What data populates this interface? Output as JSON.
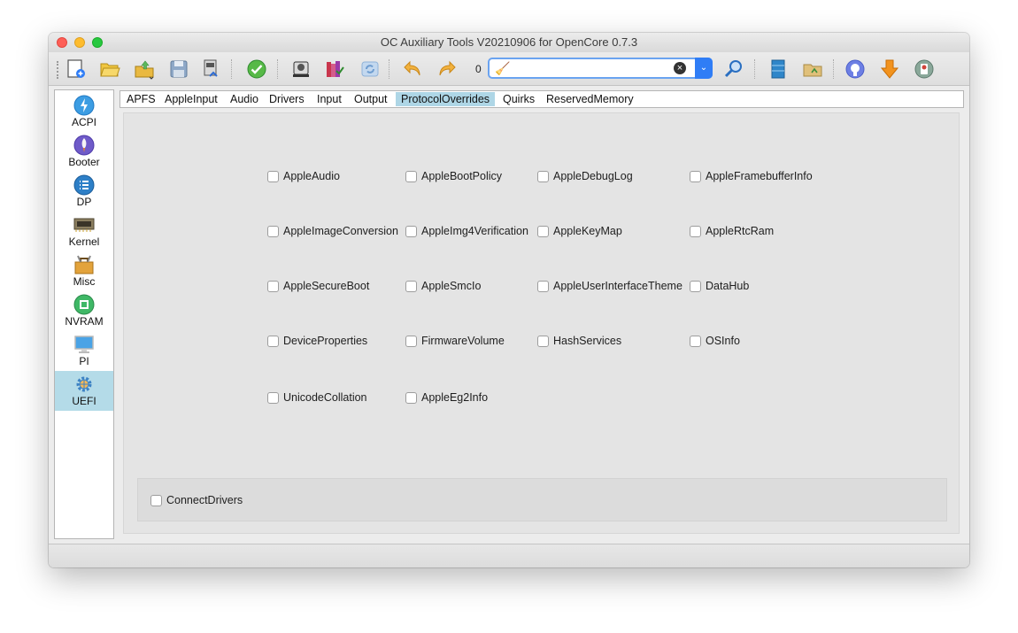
{
  "window": {
    "title": "OC Auxiliary Tools   V20210906 for OpenCore 0.7.3"
  },
  "toolbar": {
    "count": "0",
    "search": {
      "value": "",
      "placeholder": ""
    },
    "buttons": [
      {
        "name": "new-file",
        "icon": "new-document-icon"
      },
      {
        "name": "open-file",
        "icon": "folder-open-icon"
      },
      {
        "name": "open-recent",
        "icon": "folder-upload-icon"
      },
      {
        "name": "save",
        "icon": "floppy-disk-icon"
      },
      {
        "name": "save-as",
        "icon": "save-as-icon"
      },
      {
        "name": "check",
        "icon": "checkmark-icon"
      },
      {
        "name": "mount-esp",
        "icon": "disk-mount-icon"
      },
      {
        "name": "generate-ef",
        "icon": "books-icon"
      },
      {
        "name": "refresh",
        "icon": "refresh-icon"
      },
      {
        "name": "undo",
        "icon": "undo-arrow-icon"
      },
      {
        "name": "redo",
        "icon": "redo-arrow-icon"
      },
      {
        "name": "find",
        "icon": "magnifier-icon"
      },
      {
        "name": "database",
        "icon": "database-icon"
      },
      {
        "name": "open-dir",
        "icon": "folder-icon"
      },
      {
        "name": "github",
        "icon": "github-icon"
      },
      {
        "name": "download",
        "icon": "download-arrow-icon"
      },
      {
        "name": "about",
        "icon": "app-info-icon"
      }
    ]
  },
  "sidebar": {
    "items": [
      {
        "label": "ACPI",
        "icon": "lightning-icon"
      },
      {
        "label": "Booter",
        "icon": "rocket-icon"
      },
      {
        "label": "DP",
        "icon": "list-icon"
      },
      {
        "label": "Kernel",
        "icon": "chip-icon"
      },
      {
        "label": "Misc",
        "icon": "toolbox-icon"
      },
      {
        "label": "NVRAM",
        "icon": "cpu-icon"
      },
      {
        "label": "PI",
        "icon": "monitor-icon"
      },
      {
        "label": "UEFI",
        "icon": "gear-icon",
        "active": true
      }
    ]
  },
  "tabs": [
    {
      "label": "APFS"
    },
    {
      "label": "AppleInput"
    },
    {
      "label": "Audio"
    },
    {
      "label": "Drivers"
    },
    {
      "label": "Input"
    },
    {
      "label": "Output"
    },
    {
      "label": "ProtocolOverrides",
      "active": true
    },
    {
      "label": "Quirks"
    },
    {
      "label": "ReservedMemory"
    }
  ],
  "protocol_overrides": {
    "options": [
      {
        "label": "AppleAudio",
        "checked": false
      },
      {
        "label": "AppleBootPolicy",
        "checked": false
      },
      {
        "label": "AppleDebugLog",
        "checked": false
      },
      {
        "label": "AppleFramebufferInfo",
        "checked": false
      },
      {
        "label": "AppleImageConversion",
        "checked": false
      },
      {
        "label": "AppleImg4Verification",
        "checked": false
      },
      {
        "label": "AppleKeyMap",
        "checked": false
      },
      {
        "label": "AppleRtcRam",
        "checked": false
      },
      {
        "label": "AppleSecureBoot",
        "checked": false
      },
      {
        "label": "AppleSmcIo",
        "checked": false
      },
      {
        "label": "AppleUserInterfaceTheme",
        "checked": false
      },
      {
        "label": "DataHub",
        "checked": false
      },
      {
        "label": "DeviceProperties",
        "checked": false
      },
      {
        "label": "FirmwareVolume",
        "checked": false
      },
      {
        "label": "HashServices",
        "checked": false
      },
      {
        "label": "OSInfo",
        "checked": false
      },
      {
        "label": "UnicodeCollation",
        "checked": false
      },
      {
        "label": "AppleEg2Info",
        "checked": false
      }
    ],
    "connect_drivers": {
      "label": "ConnectDrivers",
      "checked": false
    }
  },
  "colors": {
    "active_tab": "#aed6e6",
    "active_sidebar": "#b4dbe8",
    "search_accent": "#2f7df6"
  }
}
